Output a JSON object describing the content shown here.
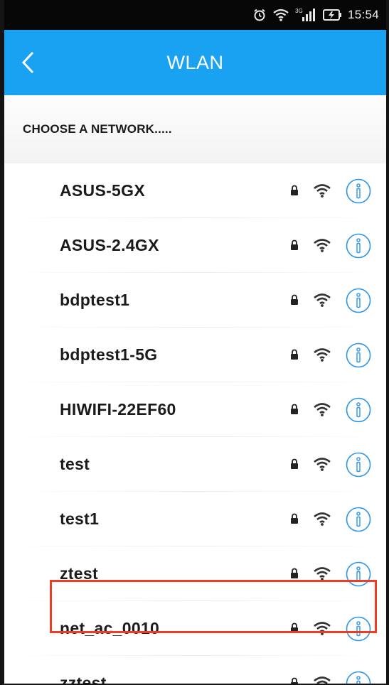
{
  "status_bar": {
    "time": "15:54",
    "network_type": "3G",
    "icons": [
      "alarm-icon",
      "wifi-icon",
      "signal-icon",
      "battery-charging-icon"
    ]
  },
  "app_bar": {
    "back_icon": "chevron-left-icon",
    "title": "WLAN",
    "color": "#1aa2f2"
  },
  "section": {
    "header": "CHOOSE A NETWORK....."
  },
  "networks": [
    {
      "name": "ASUS-5GX",
      "secured": true,
      "info_icon": "info-icon"
    },
    {
      "name": "ASUS-2.4GX",
      "secured": true,
      "info_icon": "info-icon"
    },
    {
      "name": "bdptest1",
      "secured": true,
      "info_icon": "info-icon"
    },
    {
      "name": "bdptest1-5G",
      "secured": true,
      "info_icon": "info-icon"
    },
    {
      "name": "HIWIFI-22EF60",
      "secured": true,
      "info_icon": "info-icon"
    },
    {
      "name": "test",
      "secured": true,
      "info_icon": "info-icon"
    },
    {
      "name": "test1",
      "secured": true,
      "info_icon": "info-icon"
    },
    {
      "name": "ztest",
      "secured": true,
      "info_icon": "info-icon"
    },
    {
      "name": "net_ac_0010",
      "secured": true,
      "info_icon": "info-icon",
      "highlighted": true
    },
    {
      "name": "zztest",
      "secured": true,
      "info_icon": "info-icon"
    }
  ],
  "highlight_color": "#ee3d25"
}
